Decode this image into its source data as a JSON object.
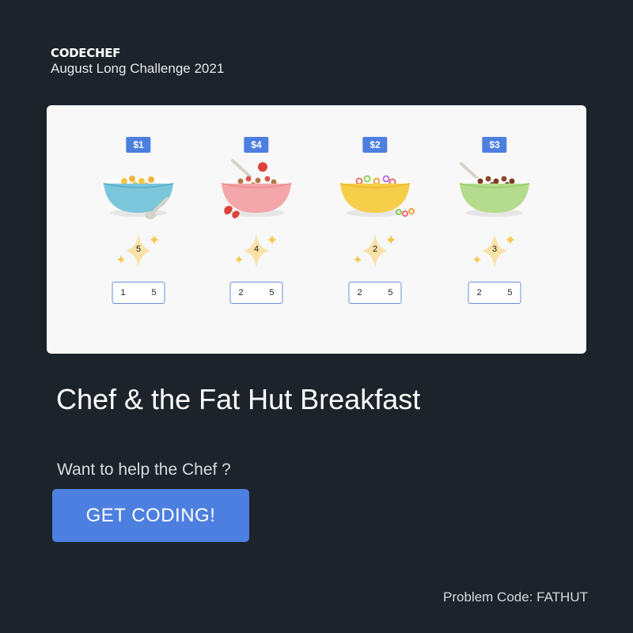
{
  "brand": "CODECHEF",
  "contest": "August Long Challenge 2021",
  "cereals": [
    {
      "price": "$1",
      "stars": "5",
      "min": "1",
      "max": "5",
      "color": "#7cc6dc"
    },
    {
      "price": "$4",
      "stars": "4",
      "min": "2",
      "max": "5",
      "color": "#f4a7aa"
    },
    {
      "price": "$2",
      "stars": "2",
      "min": "2",
      "max": "5",
      "color": "#f6cf4a"
    },
    {
      "price": "$3",
      "stars": "3",
      "min": "2",
      "max": "5",
      "color": "#b5dc8e"
    }
  ],
  "title": "Chef & the Fat Hut Breakfast",
  "prompt": "Want to help the Chef ?",
  "cta_label": "GET CODING!",
  "problem_code": "Problem Code: FATHUT",
  "colors": {
    "background": "#1c232a",
    "accent": "#4d7fe0",
    "panel": "#f8f8f8"
  }
}
